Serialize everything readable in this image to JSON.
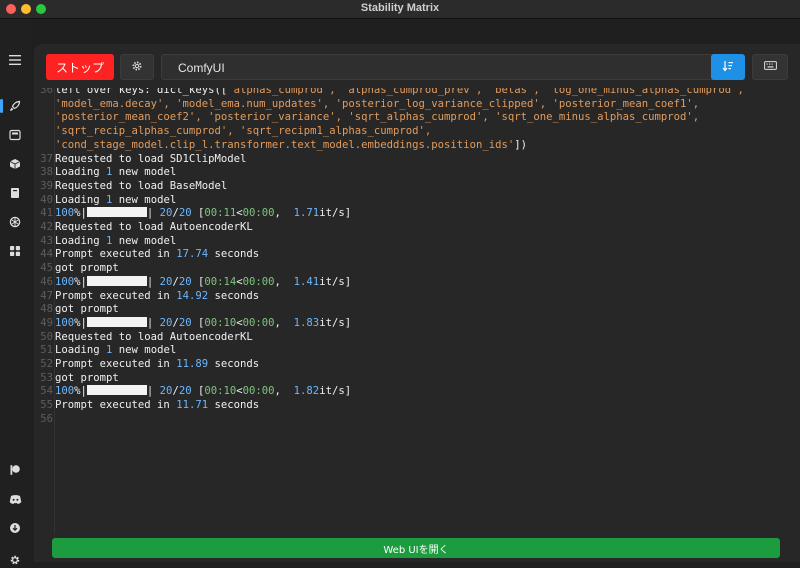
{
  "window": {
    "title": "Stability Matrix"
  },
  "sidebar": {
    "items": [
      {
        "icon": "menu-icon"
      },
      {
        "icon": "rocket-icon"
      },
      {
        "icon": "inference-icon"
      },
      {
        "icon": "package-icon"
      },
      {
        "icon": "notebook-icon"
      },
      {
        "icon": "brain-icon"
      },
      {
        "icon": "grid-icon"
      },
      {
        "icon": "patreon-icon"
      },
      {
        "icon": "discord-icon"
      },
      {
        "icon": "download-icon"
      },
      {
        "icon": "settings-icon"
      }
    ]
  },
  "toolbar": {
    "stop_label": "ストップ",
    "package_selected": "ComfyUI"
  },
  "console": {
    "lines": [
      {
        "n": "36",
        "segs": [
          [
            "t",
            "left over keys: dict_keys(["
          ],
          [
            "o",
            "'alphas_cumprod', 'alphas_cumprod_prev', 'betas', 'log_one_minus_alphas_cumprod',"
          ]
        ]
      },
      {
        "n": "",
        "segs": [
          [
            "o",
            "'model_ema.decay', 'model_ema.num_updates', 'posterior_log_variance_clipped', 'posterior_mean_coef1',"
          ]
        ]
      },
      {
        "n": "",
        "segs": [
          [
            "o",
            "'posterior_mean_coef2', 'posterior_variance', 'sqrt_alphas_cumprod', 'sqrt_one_minus_alphas_cumprod',"
          ]
        ]
      },
      {
        "n": "",
        "segs": [
          [
            "o",
            "'sqrt_recip_alphas_cumprod', 'sqrt_recipm1_alphas_cumprod',"
          ]
        ]
      },
      {
        "n": "",
        "segs": [
          [
            "o",
            "'cond_stage_model.clip_l.transformer.text_model.embeddings.position_ids'"
          ],
          [
            "t",
            "])"
          ]
        ]
      },
      {
        "n": "37",
        "segs": [
          [
            "t",
            "Requested to load SD1ClipModel"
          ]
        ]
      },
      {
        "n": "38",
        "segs": [
          [
            "t",
            "Loading "
          ],
          [
            "b",
            "1"
          ],
          [
            "t",
            " new model"
          ]
        ]
      },
      {
        "n": "39",
        "segs": [
          [
            "t",
            "Requested to load BaseModel"
          ]
        ]
      },
      {
        "n": "40",
        "segs": [
          [
            "t",
            "Loading "
          ],
          [
            "b",
            "1"
          ],
          [
            "t",
            " new model"
          ]
        ]
      },
      {
        "n": "41",
        "segs": [
          [
            "b",
            "100"
          ],
          [
            "t",
            "%|"
          ],
          [
            "bar",
            ""
          ],
          [
            "t",
            "| "
          ],
          [
            "b",
            "20"
          ],
          [
            "t",
            "/"
          ],
          [
            "b",
            "20"
          ],
          [
            "t",
            " ["
          ],
          [
            "g",
            "00:11"
          ],
          [
            "t",
            "<"
          ],
          [
            "g",
            "00:00"
          ],
          [
            "t",
            ",  "
          ],
          [
            "b",
            "1.71"
          ],
          [
            "t",
            "it/s]"
          ]
        ]
      },
      {
        "n": "42",
        "segs": [
          [
            "t",
            "Requested to load AutoencoderKL"
          ]
        ]
      },
      {
        "n": "43",
        "segs": [
          [
            "t",
            "Loading "
          ],
          [
            "b",
            "1"
          ],
          [
            "t",
            " new model"
          ]
        ]
      },
      {
        "n": "44",
        "segs": [
          [
            "t",
            "Prompt executed in "
          ],
          [
            "b",
            "17.74"
          ],
          [
            "t",
            " seconds"
          ]
        ]
      },
      {
        "n": "45",
        "segs": [
          [
            "t",
            "got prompt"
          ]
        ]
      },
      {
        "n": "46",
        "segs": [
          [
            "b",
            "100"
          ],
          [
            "t",
            "%|"
          ],
          [
            "bar",
            ""
          ],
          [
            "t",
            "| "
          ],
          [
            "b",
            "20"
          ],
          [
            "t",
            "/"
          ],
          [
            "b",
            "20"
          ],
          [
            "t",
            " ["
          ],
          [
            "g",
            "00:14"
          ],
          [
            "t",
            "<"
          ],
          [
            "g",
            "00:00"
          ],
          [
            "t",
            ",  "
          ],
          [
            "b",
            "1.41"
          ],
          [
            "t",
            "it/s]"
          ]
        ]
      },
      {
        "n": "47",
        "segs": [
          [
            "t",
            "Prompt executed in "
          ],
          [
            "b",
            "14.92"
          ],
          [
            "t",
            " seconds"
          ]
        ]
      },
      {
        "n": "48",
        "segs": [
          [
            "t",
            "got prompt"
          ]
        ]
      },
      {
        "n": "49",
        "segs": [
          [
            "b",
            "100"
          ],
          [
            "t",
            "%|"
          ],
          [
            "bar",
            ""
          ],
          [
            "t",
            "| "
          ],
          [
            "b",
            "20"
          ],
          [
            "t",
            "/"
          ],
          [
            "b",
            "20"
          ],
          [
            "t",
            " ["
          ],
          [
            "g",
            "00:10"
          ],
          [
            "t",
            "<"
          ],
          [
            "g",
            "00:00"
          ],
          [
            "t",
            ",  "
          ],
          [
            "b",
            "1.83"
          ],
          [
            "t",
            "it/s]"
          ]
        ]
      },
      {
        "n": "50",
        "segs": [
          [
            "t",
            "Requested to load AutoencoderKL"
          ]
        ]
      },
      {
        "n": "51",
        "segs": [
          [
            "t",
            "Loading "
          ],
          [
            "b",
            "1"
          ],
          [
            "t",
            " new model"
          ]
        ]
      },
      {
        "n": "52",
        "segs": [
          [
            "t",
            "Prompt executed in "
          ],
          [
            "b",
            "11.89"
          ],
          [
            "t",
            " seconds"
          ]
        ]
      },
      {
        "n": "53",
        "segs": [
          [
            "t",
            "got prompt"
          ]
        ]
      },
      {
        "n": "54",
        "segs": [
          [
            "b",
            "100"
          ],
          [
            "t",
            "%|"
          ],
          [
            "bar",
            ""
          ],
          [
            "t",
            "| "
          ],
          [
            "b",
            "20"
          ],
          [
            "t",
            "/"
          ],
          [
            "b",
            "20"
          ],
          [
            "t",
            " ["
          ],
          [
            "g",
            "00:10"
          ],
          [
            "t",
            "<"
          ],
          [
            "g",
            "00:00"
          ],
          [
            "t",
            ",  "
          ],
          [
            "b",
            "1.82"
          ],
          [
            "t",
            "it/s]"
          ]
        ]
      },
      {
        "n": "55",
        "segs": [
          [
            "t",
            "Prompt executed in "
          ],
          [
            "b",
            "11.71"
          ],
          [
            "t",
            " seconds"
          ]
        ]
      },
      {
        "n": "56",
        "segs": []
      }
    ]
  },
  "footer": {
    "launch_label": "Web UIを開く"
  },
  "colors": {
    "stop": "#ff2222",
    "accent": "#1e90e6",
    "launch": "#1c9c3e"
  }
}
